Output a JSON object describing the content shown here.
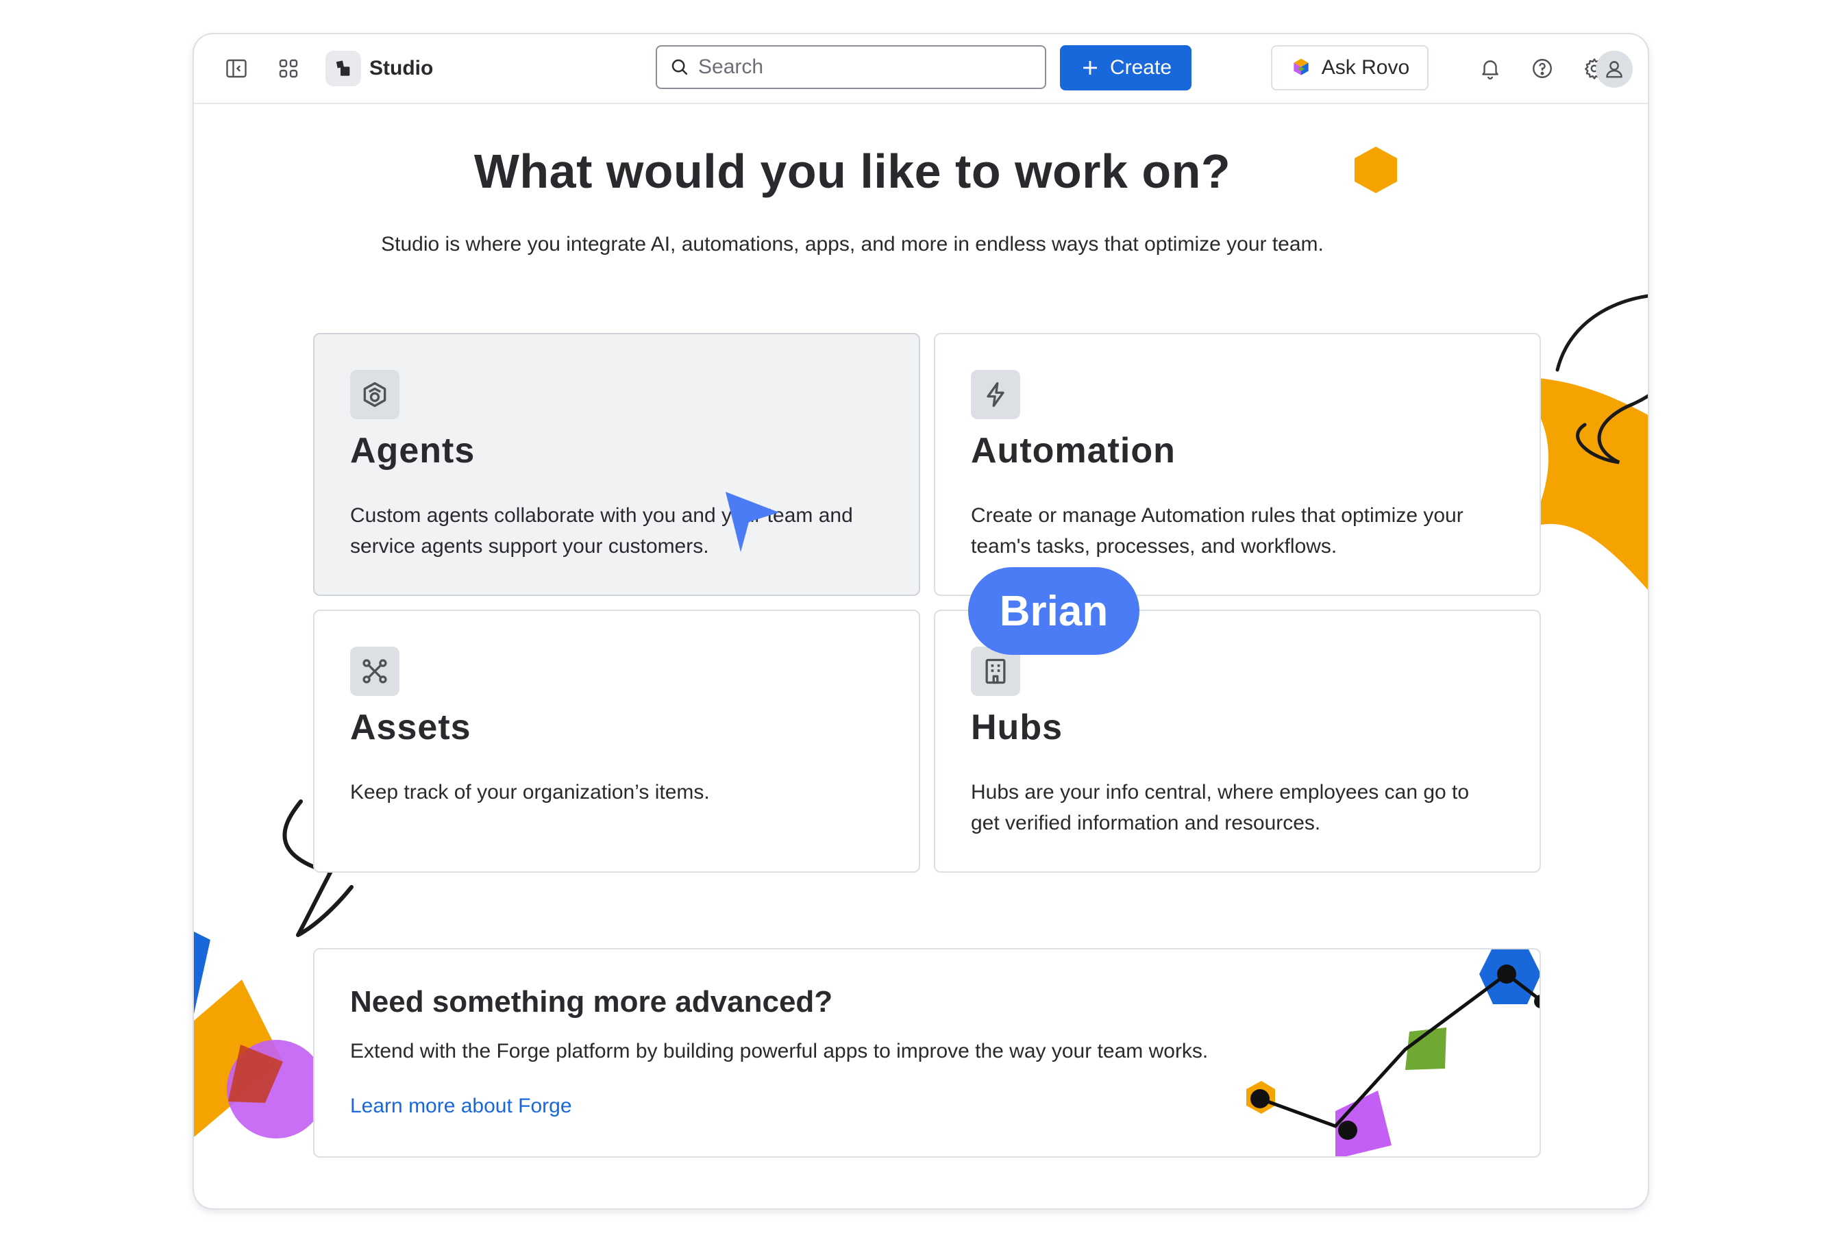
{
  "topbar": {
    "app_name": "Studio",
    "search_placeholder": "Search",
    "create_label": "Create",
    "rovo_label": "Ask Rovo",
    "icons": [
      "sidebar-toggle-icon",
      "app-switcher-icon",
      "studio-logo-icon",
      "search-icon",
      "plus-icon",
      "rovo-icon",
      "bell-icon",
      "help-icon",
      "gear-icon",
      "user-icon"
    ]
  },
  "hero": {
    "title": "What would you like to work on?",
    "subtitle": "Studio is where you integrate AI, automations, apps, and more in endless ways that optimize your team."
  },
  "cards": [
    {
      "title": "Agents",
      "description": "Custom agents collaborate with you and your team and service agents support your customers.",
      "icon": "agent-hexagon-icon"
    },
    {
      "title": "Automation",
      "description": "Create or manage Automation rules that optimize your team's tasks, processes, and workflows.",
      "icon": "lightning-icon"
    },
    {
      "title": "Assets",
      "description": "Keep track of your organization’s items.",
      "icon": "nodes-icon"
    },
    {
      "title": "Hubs",
      "description": "Hubs are your info central, where employees can go to get verified information and resources.",
      "icon": "building-icon"
    }
  ],
  "forge": {
    "title": "Need something more advanced?",
    "description": "Extend with the Forge platform by building powerful apps to improve the way your team works.",
    "link": "Learn more about Forge"
  },
  "cursor": {
    "name": "Brian",
    "color": "#4b7bf5"
  },
  "colors": {
    "brand_blue": "#1868db",
    "text": "#292a2e",
    "border": "#dcdfe4",
    "accent_orange": "#f5a300",
    "accent_purple": "#c35ff5",
    "accent_green": "#6fa832"
  }
}
